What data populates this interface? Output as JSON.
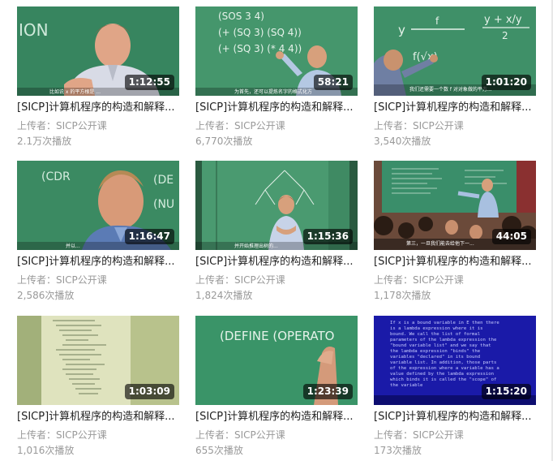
{
  "videos": [
    {
      "title": "[SICP]计算机程序的构造和解释...",
      "uploader_label": "上传者：",
      "uploader": "SICP公开课",
      "views": "2.1万次播放",
      "duration": "1:12:55",
      "thumb": "man-speaking-board"
    },
    {
      "title": "[SICP]计算机程序的构造和解释...",
      "uploader_label": "上传者：",
      "uploader": "SICP公开课",
      "views": "6,770次播放",
      "duration": "58:21",
      "thumb": "man-writing-board"
    },
    {
      "title": "[SICP]计算机程序的构造和解释...",
      "uploader_label": "上传者：",
      "uploader": "SICP公开课",
      "views": "3,540次播放",
      "duration": "1:01:20",
      "thumb": "hand-writing-board"
    },
    {
      "title": "[SICP]计算机程序的构造和解释...",
      "uploader_label": "上传者：",
      "uploader": "SICP公开课",
      "views": "2,586次播放",
      "duration": "1:16:47",
      "thumb": "man-closeup-board"
    },
    {
      "title": "[SICP]计算机程序的构造和解释...",
      "uploader_label": "上传者：",
      "uploader": "SICP公开课",
      "views": "1,824次播放",
      "duration": "1:15:36",
      "thumb": "man-center-tree-diagram"
    },
    {
      "title": "[SICP]计算机程序的构造和解释...",
      "uploader_label": "上传者：",
      "uploader": "SICP公开课",
      "views": "1,178次播放",
      "duration": "44:05",
      "thumb": "classroom-audience"
    },
    {
      "title": "[SICP]计算机程序的构造和解释...",
      "uploader_label": "上传者：",
      "uploader": "SICP公开课",
      "views": "1,016次播放",
      "duration": "1:03:09",
      "thumb": "code-printout"
    },
    {
      "title": "[SICP]计算机程序的构造和解释...",
      "uploader_label": "上传者：",
      "uploader": "SICP公开课",
      "views": "655次播放",
      "duration": "1:23:39",
      "thumb": "hand-writing-define"
    },
    {
      "title": "[SICP]计算机程序的构造和解释...",
      "uploader_label": "上传者：",
      "uploader": "SICP公开课",
      "views": "173次播放",
      "duration": "1:15:20",
      "thumb": "blue-text-slide"
    }
  ],
  "thumb_text": {
    "t1": "ION",
    "t2": [
      "(SOS 3 4)",
      "(+ (SQ 3) (SQ 4))",
      "(+ (SQ 3) (* 4 4))"
    ],
    "t3": [
      "y",
      "f",
      "y + x/y",
      "2",
      "f(√x)"
    ],
    "t4": [
      "(CDR",
      "(DE",
      "(NU"
    ],
    "t8": "(DEFINE (OPERATO",
    "t9": [
      "If x is a bound variable in E then there",
      "is a lambda expression where it is",
      "bound.  We call the list of formal",
      "parameters of the lambda expression the",
      "\"bound variable list\" and we say that",
      "the lambda expression \"binds\" the",
      "variables \"declared\" in its bound",
      "variable list.  In addition, those parts",
      "of the expression where a variable has a",
      "value defined by the lambda expression",
      "which binds it is called the \"scope\" of",
      "the variable"
    ],
    "subtitles": [
      "比如说 x 的平方根是 ...",
      "为首先，还可以提炼名字的格式化方",
      "我们还需要一个数 f 对对象做的平方...",
      "并以...",
      "并开始推理出树的...",
      "第三，一旦我们能去给他下一..."
    ]
  },
  "colors": {
    "chalkboard": "#3f8f68",
    "title_text": "#222222",
    "meta_text": "#999999",
    "duration_bg": "rgba(0,0,0,0.62)"
  }
}
